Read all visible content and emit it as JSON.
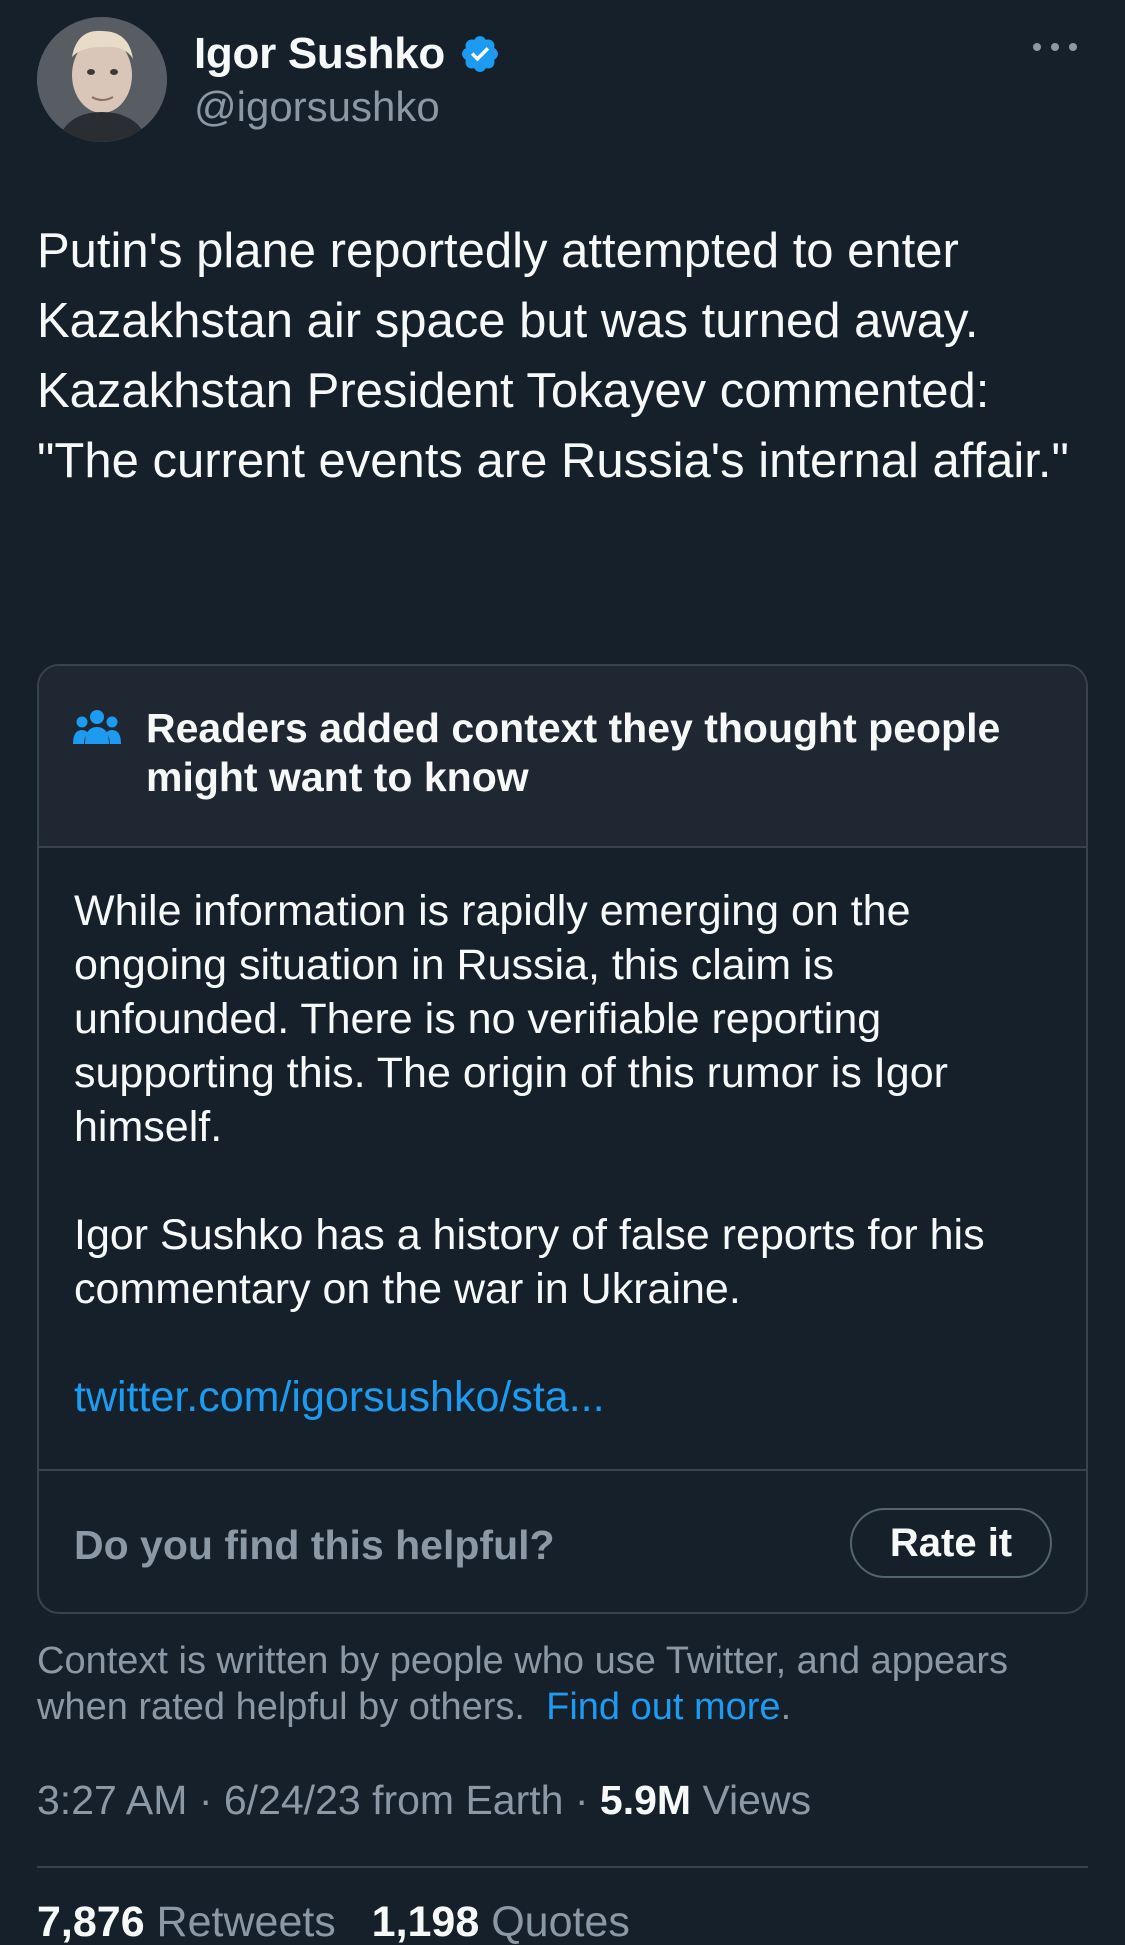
{
  "author": {
    "display_name": "Igor Sushko",
    "handle": "@igorsushko",
    "verified_icon": "verified-badge-icon",
    "more_icon": "more-horizontal-icon"
  },
  "tweet": {
    "text": "Putin's plane reportedly attempted to enter Kazakhstan air space but was turned away. Kazakhstan President Tokayev commented: \"The current events are Russia's internal affair.\""
  },
  "community_note": {
    "icon": "people-icon",
    "title": "Readers added context they thought people might want to know",
    "paragraph_1": "While information is rapidly emerging on the ongoing situation in Russia, this claim is unfounded. There is no verifiable reporting supporting this. The origin of this rumor is Igor himself.",
    "paragraph_2": "Igor Sushko has a history of false reports for his commentary on the war in Ukraine.",
    "link": "twitter.com/igorsushko/sta...",
    "helpful_question": "Do you find this helpful?",
    "rate_button": "Rate it"
  },
  "context_info": {
    "text": "Context is written by people who use Twitter, and appears when rated helpful by others.",
    "link": "Find out more",
    "trailing": "."
  },
  "meta": {
    "time": "3:27 AM",
    "sep1": " · ",
    "date": "6/24/23",
    "source": " from Earth",
    "sep2": " · ",
    "views_count": "5.9M",
    "views_label": " Views"
  },
  "stats": {
    "retweets_count": "7,876",
    "retweets_label": " Retweets",
    "quotes_count": "1,198",
    "quotes_label": " Quotes"
  },
  "colors": {
    "background": "#15202b",
    "accent": "#1d9bf0",
    "secondary_text": "#8b98a5",
    "border": "#38444d",
    "note_header_bg": "#1e2732"
  }
}
